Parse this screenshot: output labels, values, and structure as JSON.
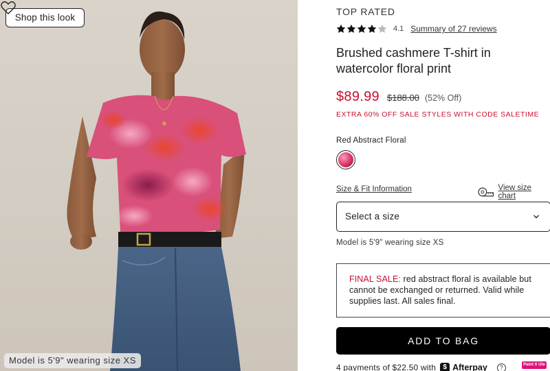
{
  "image_panel": {
    "shop_look_label": "Shop this look",
    "favorite_icon": "heart-outline-icon",
    "model_caption": "Model is 5'9\" wearing size XS"
  },
  "product": {
    "badge": "TOP RATED",
    "rating": {
      "stars": 4.1,
      "value_text": "4.1",
      "reviews_link": "Summary of 27 reviews"
    },
    "title": "Brushed cashmere T-shirt in watercolor floral print",
    "price": {
      "sale": "$89.99",
      "original": "$188.00",
      "discount": "(52% Off)"
    },
    "promo": "EXTRA 60% OFF SALE STYLES WITH CODE SALETIME",
    "color": {
      "name": "Red Abstract Floral",
      "swatch_icon": "color-swatch"
    },
    "size": {
      "fit_link": "Size & Fit Information",
      "chart_link": "View size chart",
      "chart_icon": "measuring-tape-icon",
      "select_label": "Select a size",
      "model_note": "Model is 5'9\" wearing size XS"
    },
    "final_sale": {
      "label": "FINAL SALE:",
      "text": " red abstract floral is available but cannot be exchanged or returned. Valid while supplies last. All sales final."
    },
    "add_to_bag": "ADD TO BAG",
    "payment": {
      "text": "4 payments of $22.50 with",
      "logo_mark": "$",
      "provider": "Afterpay",
      "help_icon": "question-circle-icon"
    },
    "extension_badge": "Paint X Ute"
  },
  "colors": {
    "accent_red": "#c8102e",
    "button_black": "#000000",
    "swatch_pink": "#e64d7c"
  }
}
